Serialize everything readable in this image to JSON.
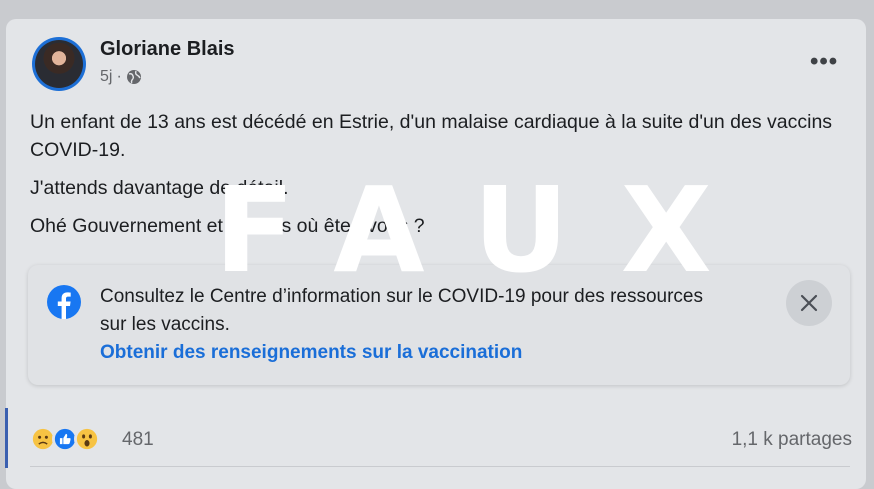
{
  "post": {
    "author": "Gloriane Blais",
    "time": "5j",
    "separator": "·",
    "more_icon": "•••",
    "paragraphs": [
      "Un enfant de 13 ans est décédé en Estrie, d'un malaise cardiaque à la suite d'un des vaccins COVID-19.",
      "J'attends davantage de détail.",
      "Ohé Gouvernement et Médias où êtes-vous ?"
    ]
  },
  "info_box": {
    "text": "Consultez le Centre d’information sur le COVID-19 pour des ressources sur les vaccins.",
    "link": "Obtenir des renseignements sur la vaccination",
    "close_icon": "close-icon"
  },
  "footer": {
    "reaction_count": "481",
    "shares": "1,1 k partages",
    "reactions": [
      "sad",
      "like",
      "wow"
    ]
  },
  "stamp": "FAUX",
  "colors": {
    "link": "#1a6ed8",
    "facebook": "#1877f2",
    "stamp": "#ffffff"
  }
}
